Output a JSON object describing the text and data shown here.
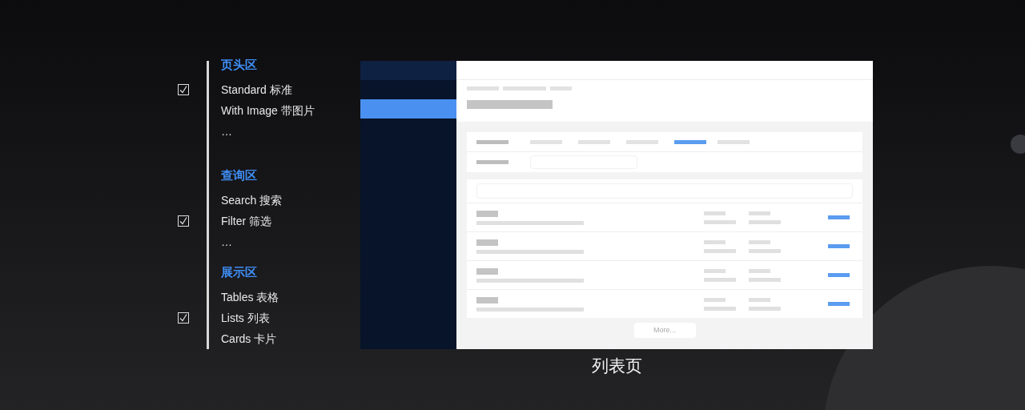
{
  "outline": {
    "sections": [
      {
        "title": "页头区",
        "items": [
          {
            "label": "Standard 标准",
            "checked": true
          },
          {
            "label": "With Image 带图片",
            "checked": false
          },
          {
            "label": "…",
            "checked": false
          }
        ]
      },
      {
        "title": "查询区",
        "items": [
          {
            "label": "Search 搜索",
            "checked": false
          },
          {
            "label": "Filter 筛选",
            "checked": true
          },
          {
            "label": "…",
            "checked": false
          }
        ]
      },
      {
        "title": "展示区",
        "items": [
          {
            "label": "Tables 表格",
            "checked": false
          },
          {
            "label": "Lists 列表",
            "checked": true
          },
          {
            "label": "Cards 卡片",
            "checked": false
          }
        ]
      }
    ]
  },
  "wireframe": {
    "sidebar": {
      "items": [
        {
          "selected": false
        },
        {
          "selected": true
        }
      ]
    },
    "tabs": [
      {
        "selected": false
      },
      {
        "selected": false
      },
      {
        "selected": false
      },
      {
        "selected": true
      },
      {
        "selected": false
      }
    ],
    "rows": [
      {
        "kind": "item"
      },
      {
        "kind": "item"
      },
      {
        "kind": "item"
      },
      {
        "kind": "item"
      }
    ],
    "more_button": "More..."
  },
  "caption": "列表页"
}
